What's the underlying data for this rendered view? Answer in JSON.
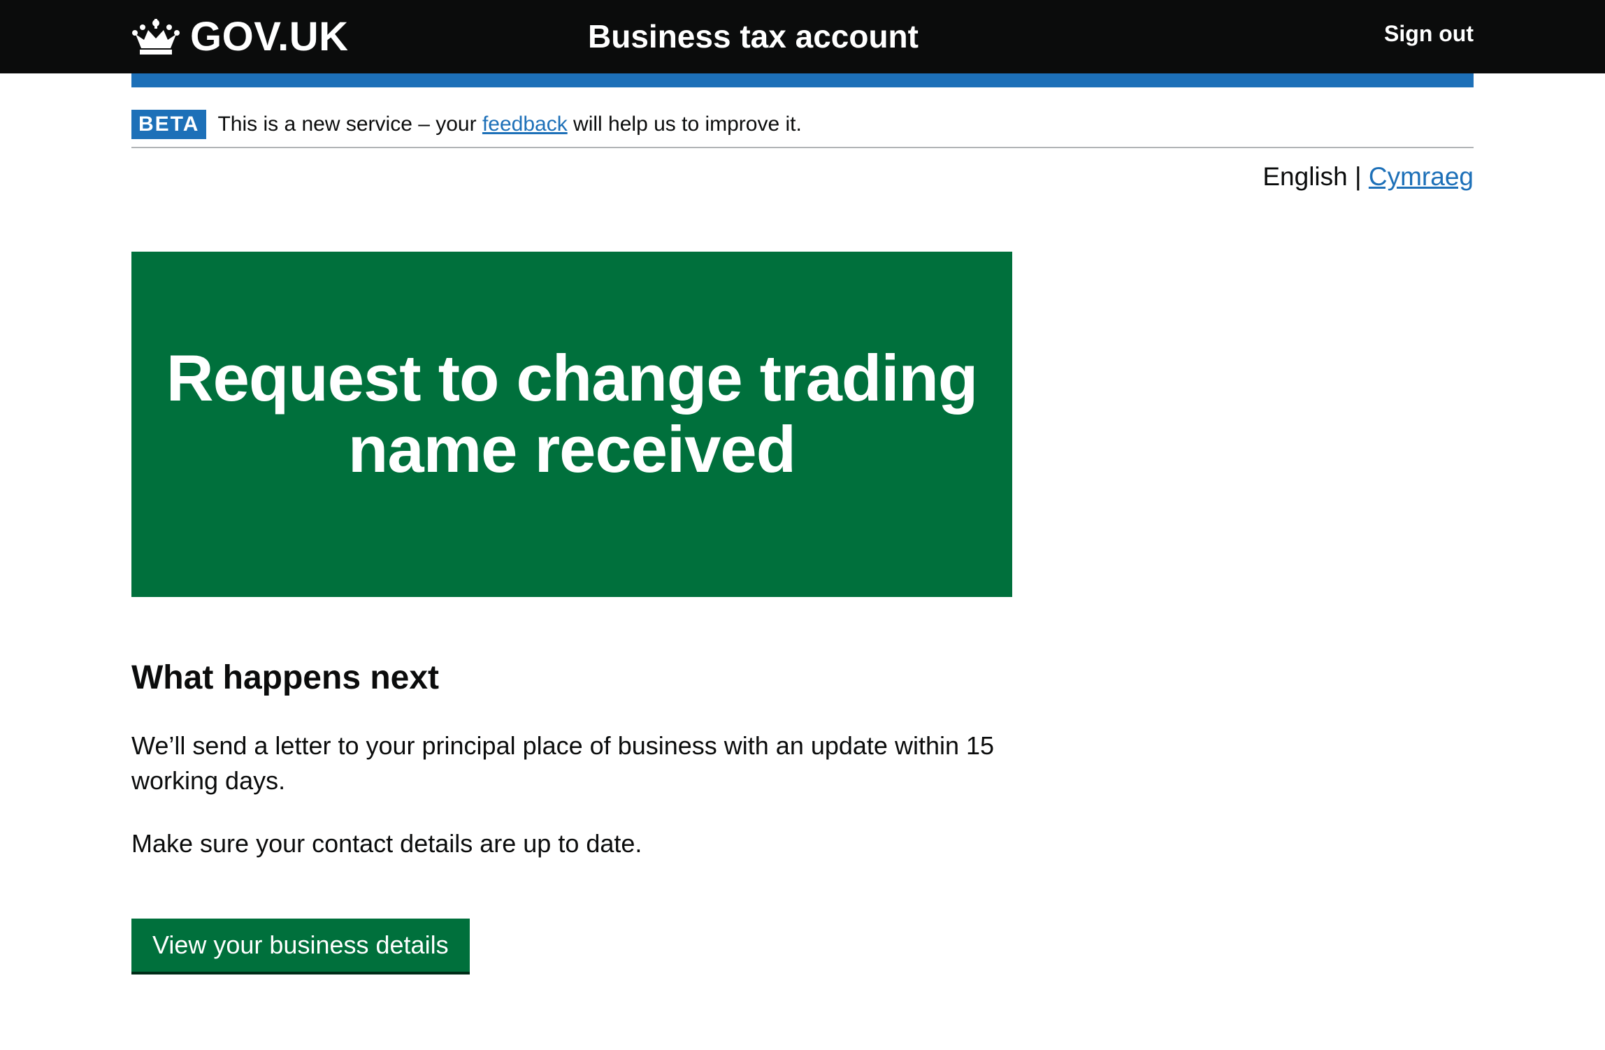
{
  "header": {
    "logo_text": "GOV.UK",
    "service_name": "Business tax account",
    "sign_out_label": "Sign out"
  },
  "phase_banner": {
    "tag": "BETA",
    "text_before": "This is a new service – your ",
    "link_text": "feedback",
    "text_after": " will help us to improve it."
  },
  "language": {
    "current": "English",
    "separator": " | ",
    "other": "Cymraeg"
  },
  "panel": {
    "title": "Request to change trading name received"
  },
  "content": {
    "heading": "What happens next",
    "paragraph1": "We’ll send a letter to your principal place of business with an update within 15 working days.",
    "paragraph2": "Make sure your contact details are up to date."
  },
  "button": {
    "label": "View your business details"
  },
  "colors": {
    "header_bg": "#0b0c0c",
    "brand_blue": "#1d70b8",
    "success_green": "#00703c"
  }
}
